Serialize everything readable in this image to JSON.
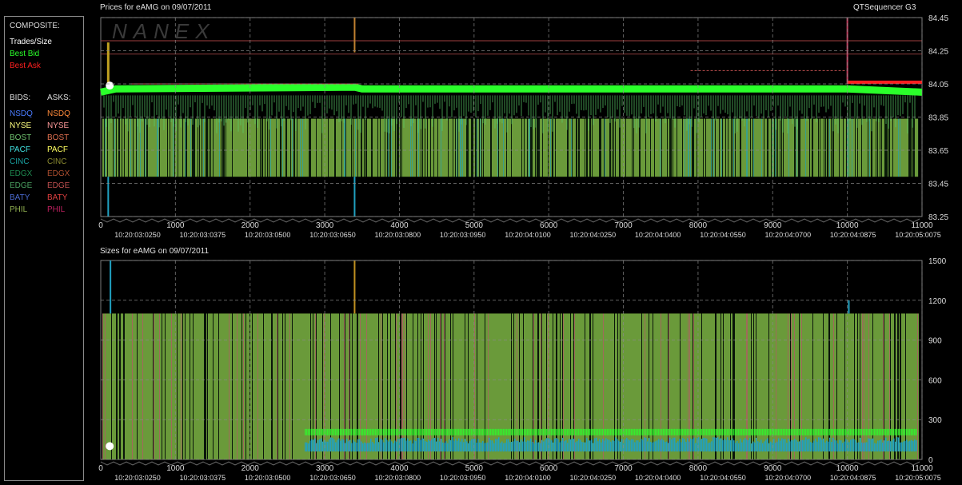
{
  "app_title": "QTSequencer G3",
  "watermark": "NANEX",
  "legend": {
    "composite_heading": "COMPOSITE:",
    "composite": [
      {
        "label": "Trades/Size",
        "color": "#ffffff"
      },
      {
        "label": "Best Bid",
        "color": "#2aff2a"
      },
      {
        "label": "Best Ask",
        "color": "#ff2020"
      }
    ],
    "bids_heading": "BIDS:",
    "asks_heading": "ASKS:",
    "exchanges": [
      {
        "bid": "NSDQ",
        "ask": "NSDQ",
        "bid_color": "#4a7bff",
        "ask_color": "#ff8a3a"
      },
      {
        "bid": "NYSE",
        "ask": "NYSE",
        "bid_color": "#ffff80",
        "ask_color": "#ff9a9a"
      },
      {
        "bid": "BOST",
        "ask": "BOST",
        "bid_color": "#6ec06e",
        "ask_color": "#e07050"
      },
      {
        "bid": "PACF",
        "ask": "PACF",
        "bid_color": "#40e0e0",
        "ask_color": "#ffff60"
      },
      {
        "bid": "CINC",
        "ask": "CINC",
        "bid_color": "#1aa0a0",
        "ask_color": "#8a8a30"
      },
      {
        "bid": "EDGX",
        "ask": "EDGX",
        "bid_color": "#1e8a50",
        "ask_color": "#b05030"
      },
      {
        "bid": "EDGE",
        "ask": "EDGE",
        "bid_color": "#4aa060",
        "ask_color": "#c05050"
      },
      {
        "bid": "BATY",
        "ask": "BATY",
        "bid_color": "#4a6ad0",
        "ask_color": "#e04040"
      },
      {
        "bid": "PHIL",
        "ask": "PHIL",
        "bid_color": "#90b050",
        "ask_color": "#c02060"
      }
    ]
  },
  "chart_data": [
    {
      "type": "line",
      "title": "Prices for  eAMG  on  09/07/2011",
      "ylim": [
        83.25,
        84.45
      ],
      "xlim": [
        0,
        11000
      ],
      "yticks": [
        "84.45",
        "84.25",
        "84.05",
        "83.85",
        "83.65",
        "83.45",
        "83.25"
      ],
      "ytick_values": [
        84.45,
        84.25,
        84.05,
        83.85,
        83.65,
        83.45,
        83.25
      ],
      "xticks": [
        "0",
        "1000",
        "2000",
        "3000",
        "4000",
        "5000",
        "6000",
        "7000",
        "8000",
        "9000",
        "10000",
        "11000"
      ],
      "xtick_values": [
        0,
        1000,
        2000,
        3000,
        4000,
        5000,
        6000,
        7000,
        8000,
        9000,
        10000,
        11000
      ],
      "time_labels": [
        "10:20:03:0250",
        "10:20:03:0375",
        "10:20:03:0500",
        "10:20:03:0650",
        "10:20:03:0800",
        "10:20:03:0950",
        "10:20:04:0100",
        "10:20:04:0250",
        "10:20:04:0400",
        "10:20:04:0550",
        "10:20:04:0700",
        "10:20:04:0875",
        "10:20:05:0075"
      ],
      "grid": true,
      "series": [
        {
          "name": "Best Bid",
          "color": "#2aff2a",
          "x": [
            0,
            200,
            3400,
            3500,
            10000,
            11000
          ],
          "y": [
            84.0,
            84.02,
            84.03,
            84.02,
            84.02,
            84.0
          ]
        },
        {
          "name": "Best Ask",
          "color": "#ff2020",
          "x": [
            10000,
            10500,
            11000
          ],
          "y": [
            84.06,
            84.06,
            84.06
          ]
        },
        {
          "name": "Trades/Size",
          "color": "#ffffff",
          "x": [
            120
          ],
          "y": [
            84.04
          ]
        }
      ],
      "band": {
        "low": 83.49,
        "high": 83.84,
        "color": "#6a9a3a"
      }
    },
    {
      "type": "bar",
      "title": "Sizes for  eAMG  on  09/07/2011",
      "ylim": [
        0,
        1500
      ],
      "xlim": [
        0,
        11000
      ],
      "yticks": [
        "1500",
        "1200",
        "900",
        "600",
        "300",
        "0"
      ],
      "ytick_values": [
        1500,
        1200,
        900,
        600,
        300,
        0
      ],
      "xticks": [
        "0",
        "1000",
        "2000",
        "3000",
        "4000",
        "5000",
        "6000",
        "7000",
        "8000",
        "9000",
        "10000",
        "11000"
      ],
      "xtick_values": [
        0,
        1000,
        2000,
        3000,
        4000,
        5000,
        6000,
        7000,
        8000,
        9000,
        10000,
        11000
      ],
      "time_labels": [
        "10:20:03:0250",
        "10:20:03:0375",
        "10:20:03:0500",
        "10:20:03:0650",
        "10:20:03:0800",
        "10:20:03:0950",
        "10:20:04:0100",
        "10:20:04:0250",
        "10:20:04:0400",
        "10:20:04:0550",
        "10:20:04:0700",
        "10:20:04:0875",
        "10:20:05:0075"
      ],
      "grid": true,
      "fill_level": 1100,
      "spikes": [
        {
          "x": 130,
          "y": 1500,
          "color": "#20a0c0"
        },
        {
          "x": 3400,
          "y": 1500,
          "color": "#c09020"
        },
        {
          "x": 10020,
          "y": 1200,
          "color": "#20a0c0"
        }
      ],
      "trade_points": [
        {
          "x": 120,
          "y": 100,
          "color": "#ffffff"
        }
      ]
    }
  ]
}
